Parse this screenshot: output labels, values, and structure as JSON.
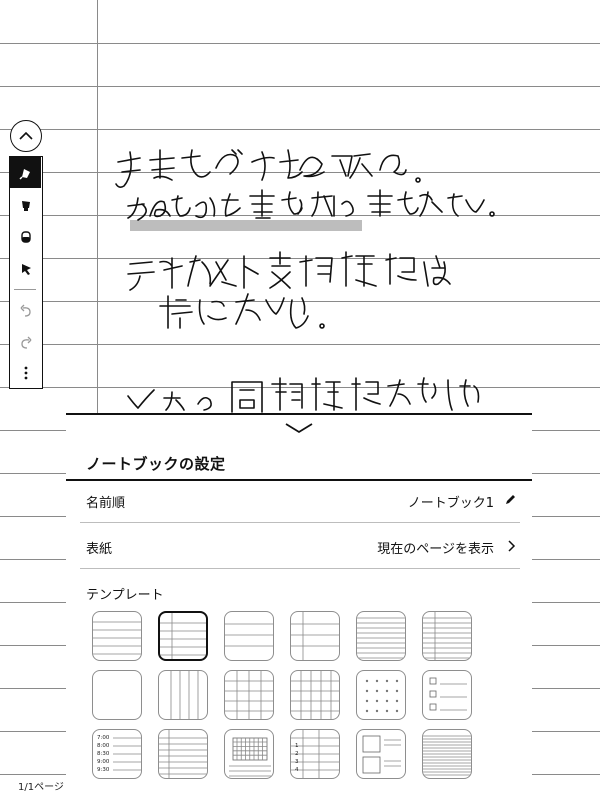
{
  "handwriting": {
    "line1": "手書きでメモを取れる。",
    "line2": "なめらかな書き味で書きやすい。",
    "line3": "テキスト変換機能は",
    "line4": "特にない。",
    "line5": "メモの同期機能がほしい"
  },
  "toolbar": {
    "toggle_icon": "chevron-up-icon",
    "tools": [
      "pen-icon",
      "marker-icon",
      "eraser-icon",
      "lasso-icon",
      "undo-icon",
      "redo-icon",
      "more-icon"
    ],
    "active_tool": "pen-icon"
  },
  "sheet": {
    "title": "ノートブックの設定",
    "name_label": "名前順",
    "name_value": "ノートブック1",
    "cover_label": "表紙",
    "cover_value": "現在のページを表示",
    "templates_label": "テンプレート",
    "templates": [
      "lined",
      "lined-margin",
      "lined-wide",
      "lined-margin-wide",
      "lined-narrow",
      "lined-narrow-margin",
      "blank",
      "columns",
      "columns-lined",
      "grid",
      "dot-grid",
      "checklist",
      "schedule",
      "table",
      "calendar",
      "numbered-list",
      "storyboard",
      "dense-lined"
    ],
    "selected_template": "lined-margin",
    "schedule_times": [
      "7:00",
      "8:00",
      "8:30",
      "9:00",
      "9:30"
    ],
    "numbered_rows": [
      "1",
      "2",
      "3",
      "4"
    ]
  },
  "footer": {
    "page_indicator": "1/1ページ"
  }
}
